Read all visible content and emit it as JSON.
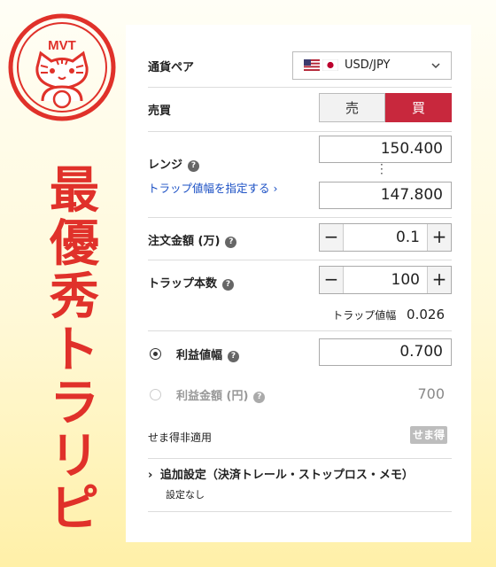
{
  "stamp": {
    "text": "MVT"
  },
  "title_chars": [
    "最",
    "優",
    "秀",
    "ト",
    "ラ",
    "リ",
    "ピ"
  ],
  "currency_pair": {
    "label": "通貨ペア",
    "value": "USD/JPY"
  },
  "buysell": {
    "label": "売買",
    "sell": "売",
    "buy": "買"
  },
  "range": {
    "label": "レンジ",
    "trap_link": "トラップ値幅を指定する",
    "upper": "150.400",
    "lower": "147.800"
  },
  "order_amount": {
    "label": "注文金額 (万)",
    "value": "0.1"
  },
  "trap_count": {
    "label": "トラップ本数",
    "value": "100"
  },
  "trap_width": {
    "label": "トラップ値幅",
    "value": "0.026"
  },
  "profit_width": {
    "label": "利益値幅",
    "value": "0.700"
  },
  "profit_amount": {
    "label": "利益金額 (円)",
    "value": "700"
  },
  "semaedoku": {
    "label": "せま得非適用",
    "badge": "せま得"
  },
  "advanced": {
    "title": "追加設定（決済トレール・ストップロス・メモ）",
    "sub": "設定なし"
  },
  "colors": {
    "accent_red": "#c8283d",
    "title_red": "#e0312a",
    "link_blue": "#1a4fc4"
  }
}
